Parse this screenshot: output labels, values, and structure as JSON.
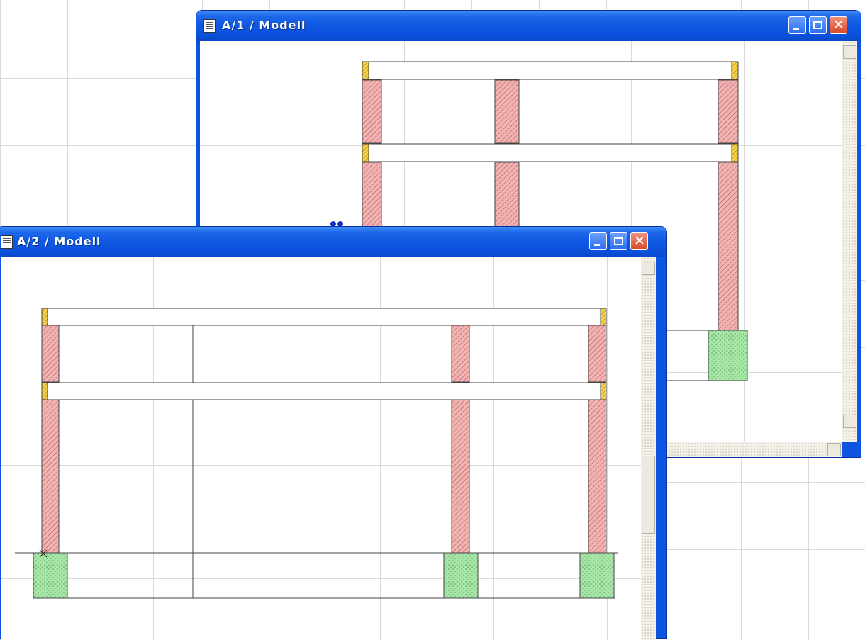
{
  "windows": [
    {
      "id": "a1",
      "title": "A/1  / Modell"
    },
    {
      "id": "a2",
      "title": "A/2  / Modell"
    }
  ],
  "icons": {
    "document": "document-icon",
    "minimize": "minimize-icon",
    "maximize": "maximize-icon",
    "close": "close-icon",
    "scroll_up": "arrow-up-icon",
    "scroll_down": "arrow-down-icon",
    "scroll_right": "arrow-right-icon"
  },
  "colors": {
    "column_fill": "#f2b3b3",
    "column_hatch": "#b35a5a",
    "footing_fill": "#a6e6a6",
    "beam_end_fill": "#f5d24a",
    "titlebar": "#0e58e2",
    "grid": "#d9d9d9"
  },
  "glyphs": {
    "close": "✕"
  }
}
